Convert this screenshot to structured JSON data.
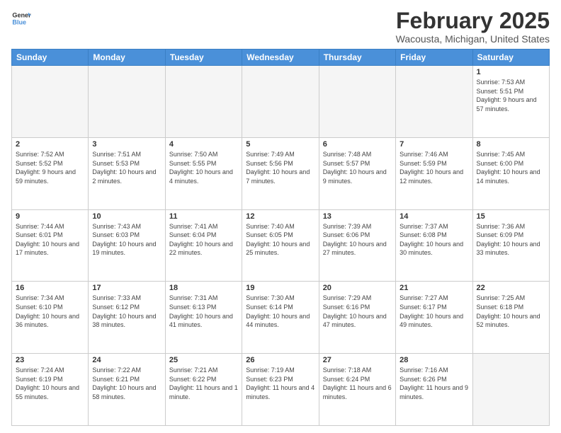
{
  "logo": {
    "line1": "General",
    "line2": "Blue"
  },
  "title": "February 2025",
  "subtitle": "Wacousta, Michigan, United States",
  "days_header": [
    "Sunday",
    "Monday",
    "Tuesday",
    "Wednesday",
    "Thursday",
    "Friday",
    "Saturday"
  ],
  "weeks": [
    [
      {
        "day": "",
        "info": ""
      },
      {
        "day": "",
        "info": ""
      },
      {
        "day": "",
        "info": ""
      },
      {
        "day": "",
        "info": ""
      },
      {
        "day": "",
        "info": ""
      },
      {
        "day": "",
        "info": ""
      },
      {
        "day": "1",
        "info": "Sunrise: 7:53 AM\nSunset: 5:51 PM\nDaylight: 9 hours and 57 minutes."
      }
    ],
    [
      {
        "day": "2",
        "info": "Sunrise: 7:52 AM\nSunset: 5:52 PM\nDaylight: 9 hours and 59 minutes."
      },
      {
        "day": "3",
        "info": "Sunrise: 7:51 AM\nSunset: 5:53 PM\nDaylight: 10 hours and 2 minutes."
      },
      {
        "day": "4",
        "info": "Sunrise: 7:50 AM\nSunset: 5:55 PM\nDaylight: 10 hours and 4 minutes."
      },
      {
        "day": "5",
        "info": "Sunrise: 7:49 AM\nSunset: 5:56 PM\nDaylight: 10 hours and 7 minutes."
      },
      {
        "day": "6",
        "info": "Sunrise: 7:48 AM\nSunset: 5:57 PM\nDaylight: 10 hours and 9 minutes."
      },
      {
        "day": "7",
        "info": "Sunrise: 7:46 AM\nSunset: 5:59 PM\nDaylight: 10 hours and 12 minutes."
      },
      {
        "day": "8",
        "info": "Sunrise: 7:45 AM\nSunset: 6:00 PM\nDaylight: 10 hours and 14 minutes."
      }
    ],
    [
      {
        "day": "9",
        "info": "Sunrise: 7:44 AM\nSunset: 6:01 PM\nDaylight: 10 hours and 17 minutes."
      },
      {
        "day": "10",
        "info": "Sunrise: 7:43 AM\nSunset: 6:03 PM\nDaylight: 10 hours and 19 minutes."
      },
      {
        "day": "11",
        "info": "Sunrise: 7:41 AM\nSunset: 6:04 PM\nDaylight: 10 hours and 22 minutes."
      },
      {
        "day": "12",
        "info": "Sunrise: 7:40 AM\nSunset: 6:05 PM\nDaylight: 10 hours and 25 minutes."
      },
      {
        "day": "13",
        "info": "Sunrise: 7:39 AM\nSunset: 6:06 PM\nDaylight: 10 hours and 27 minutes."
      },
      {
        "day": "14",
        "info": "Sunrise: 7:37 AM\nSunset: 6:08 PM\nDaylight: 10 hours and 30 minutes."
      },
      {
        "day": "15",
        "info": "Sunrise: 7:36 AM\nSunset: 6:09 PM\nDaylight: 10 hours and 33 minutes."
      }
    ],
    [
      {
        "day": "16",
        "info": "Sunrise: 7:34 AM\nSunset: 6:10 PM\nDaylight: 10 hours and 36 minutes."
      },
      {
        "day": "17",
        "info": "Sunrise: 7:33 AM\nSunset: 6:12 PM\nDaylight: 10 hours and 38 minutes."
      },
      {
        "day": "18",
        "info": "Sunrise: 7:31 AM\nSunset: 6:13 PM\nDaylight: 10 hours and 41 minutes."
      },
      {
        "day": "19",
        "info": "Sunrise: 7:30 AM\nSunset: 6:14 PM\nDaylight: 10 hours and 44 minutes."
      },
      {
        "day": "20",
        "info": "Sunrise: 7:29 AM\nSunset: 6:16 PM\nDaylight: 10 hours and 47 minutes."
      },
      {
        "day": "21",
        "info": "Sunrise: 7:27 AM\nSunset: 6:17 PM\nDaylight: 10 hours and 49 minutes."
      },
      {
        "day": "22",
        "info": "Sunrise: 7:25 AM\nSunset: 6:18 PM\nDaylight: 10 hours and 52 minutes."
      }
    ],
    [
      {
        "day": "23",
        "info": "Sunrise: 7:24 AM\nSunset: 6:19 PM\nDaylight: 10 hours and 55 minutes."
      },
      {
        "day": "24",
        "info": "Sunrise: 7:22 AM\nSunset: 6:21 PM\nDaylight: 10 hours and 58 minutes."
      },
      {
        "day": "25",
        "info": "Sunrise: 7:21 AM\nSunset: 6:22 PM\nDaylight: 11 hours and 1 minute."
      },
      {
        "day": "26",
        "info": "Sunrise: 7:19 AM\nSunset: 6:23 PM\nDaylight: 11 hours and 4 minutes."
      },
      {
        "day": "27",
        "info": "Sunrise: 7:18 AM\nSunset: 6:24 PM\nDaylight: 11 hours and 6 minutes."
      },
      {
        "day": "28",
        "info": "Sunrise: 7:16 AM\nSunset: 6:26 PM\nDaylight: 11 hours and 9 minutes."
      },
      {
        "day": "",
        "info": ""
      }
    ]
  ]
}
